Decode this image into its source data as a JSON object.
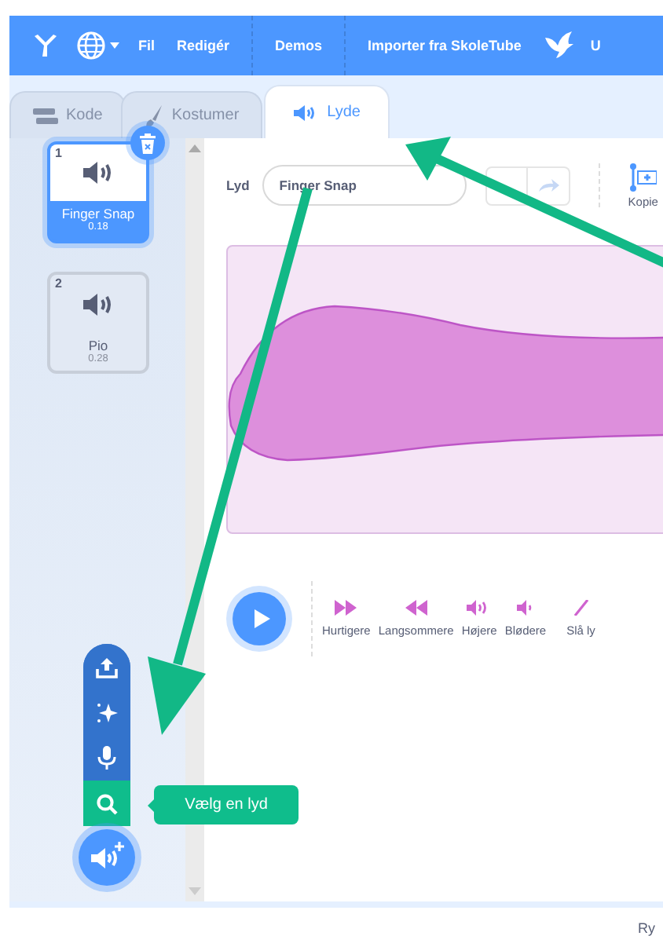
{
  "menu": {
    "items": [
      {
        "kind": "logo"
      },
      {
        "kind": "language"
      },
      {
        "kind": "text",
        "label": "Fil"
      },
      {
        "kind": "text",
        "label": "Redigér"
      },
      {
        "kind": "divider"
      },
      {
        "kind": "text",
        "label": "Demos"
      },
      {
        "kind": "divider"
      },
      {
        "kind": "text",
        "label": "Importer fra SkoleTube"
      },
      {
        "kind": "bird"
      },
      {
        "kind": "text",
        "label": "U"
      }
    ]
  },
  "tabs": [
    {
      "label": "Kode",
      "kind": "code",
      "selected": false
    },
    {
      "label": "Kostumer",
      "kind": "costumes",
      "selected": false
    },
    {
      "label": "Lyde",
      "kind": "sounds",
      "selected": true
    }
  ],
  "sounds": [
    {
      "index": "1",
      "name": "Finger Snap",
      "duration": "0.18",
      "selected": true
    },
    {
      "index": "2",
      "name": "Pio",
      "duration": "0.28",
      "selected": false
    }
  ],
  "editor": {
    "sound_label": "Lyd",
    "name_value": "Finger Snap",
    "copy_label": "Kopie",
    "effects": [
      {
        "kind": "faster",
        "label": "Hurtigere"
      },
      {
        "kind": "slower",
        "label": "Langsommere"
      },
      {
        "kind": "louder",
        "label": "Højere"
      },
      {
        "kind": "softer",
        "label": "Blødere"
      },
      {
        "kind": "mute",
        "label": "Slå ly"
      }
    ]
  },
  "add_menu": {
    "items": [
      {
        "kind": "upload",
        "selected": false
      },
      {
        "kind": "surprise",
        "selected": false
      },
      {
        "kind": "record",
        "selected": false
      },
      {
        "kind": "search",
        "selected": true
      }
    ],
    "tooltip": "Vælg en lyd"
  },
  "footer_text": "Ry"
}
